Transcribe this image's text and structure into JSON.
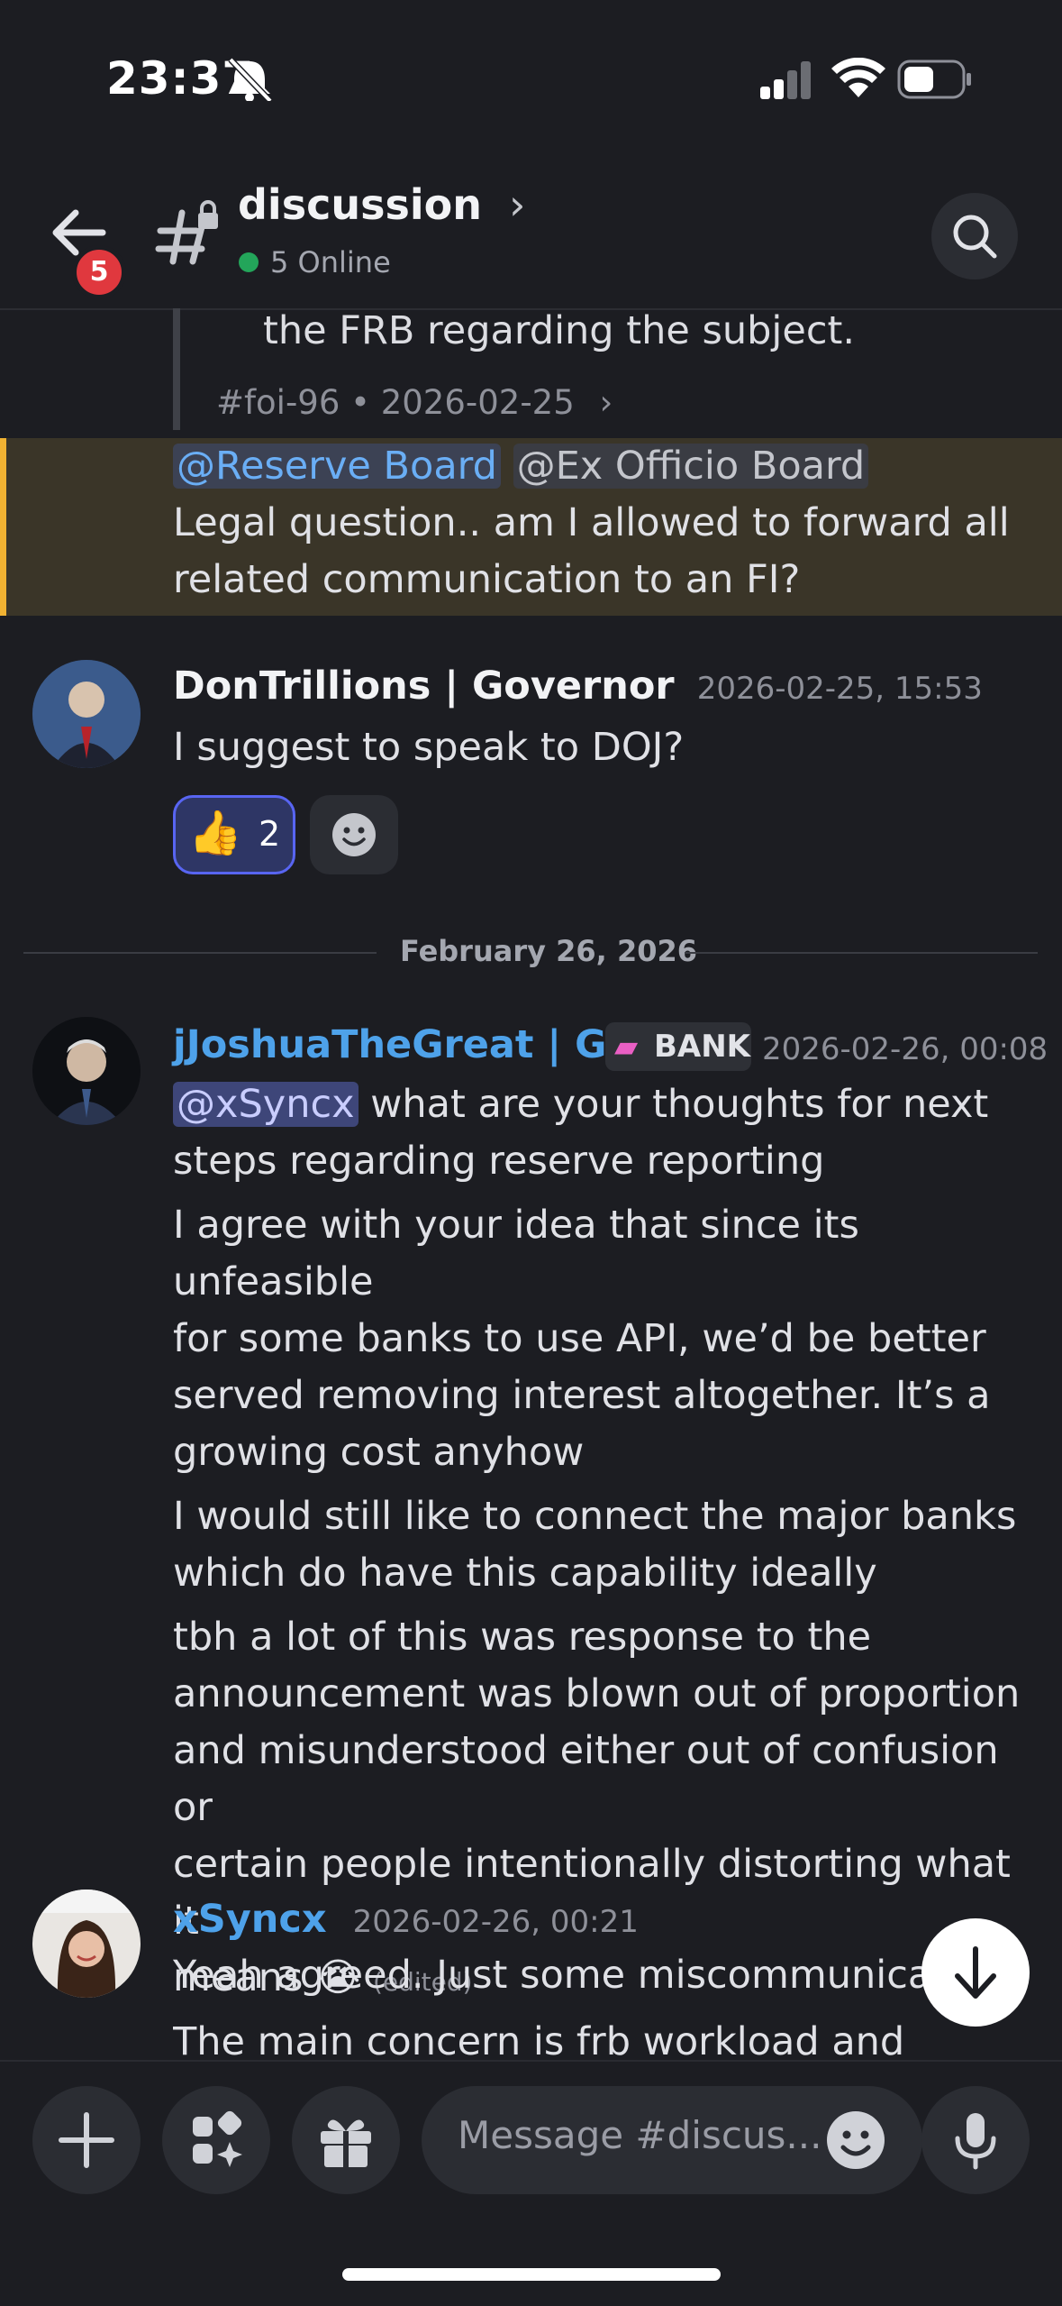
{
  "status_bar": {
    "time": "23:37"
  },
  "header": {
    "channel": "discussion",
    "chevron": "›",
    "online": "5 Online",
    "back_badge": "5"
  },
  "quoted": {
    "text": "the FRB regarding the subject.",
    "meta": "#foi-96 • 2026-02-25",
    "chevron": "›"
  },
  "highlighted": {
    "mention1": "@Reserve Board",
    "mention2": "@Ex Officio Board",
    "line1": "Legal question.. am I allowed to forward all",
    "line2": "related communication to an FI?"
  },
  "message1": {
    "author": "DonTrillions | Governor",
    "timestamp": "2026-02-25, 15:53",
    "text": "I suggest to speak to DOJ?",
    "reaction_emoji": "👍",
    "reaction_count": "2"
  },
  "date_divider": "February 26, 2026",
  "message2": {
    "author": "jJoshuaTheGreat | G...",
    "tag": "BANK",
    "timestamp": "2026-02-26, 00:08",
    "mention": "@xSyncx",
    "line1_rest": "what are your thoughts for next",
    "line2": "steps regarding reserve reporting",
    "p2_l1": "I agree with your idea that since its unfeasible",
    "p2_l2": "for some banks to use API, we’d be better",
    "p2_l3": "served removing interest altogether. It’s a",
    "p2_l4": "growing cost anyhow",
    "p3_l1": "I would still like to connect the major banks",
    "p3_l2": "which do have this capability ideally",
    "p4_l1": "tbh a lot of this was response to the",
    "p4_l2": "announcement was blown out of proportion",
    "p4_l3": "and misunderstood either out of confusion or",
    "p4_l4": "certain people intentionally distorting what it",
    "p4_l5": "means 😭",
    "edited": "(edited)"
  },
  "message3": {
    "author": "xSyncx",
    "timestamp": "2026-02-26, 00:21",
    "line1": "Yeah agreed. Just some miscommunicati",
    "line2": "The main concern is frb workload and"
  },
  "composer": {
    "placeholder": "Message #discus..."
  },
  "colors": {
    "accent_blue": "#5aa7f0",
    "mention_bg": "#3e4679",
    "highlight_bar": "#f0b232",
    "online": "#23a55a",
    "badge": "#e0383e"
  }
}
